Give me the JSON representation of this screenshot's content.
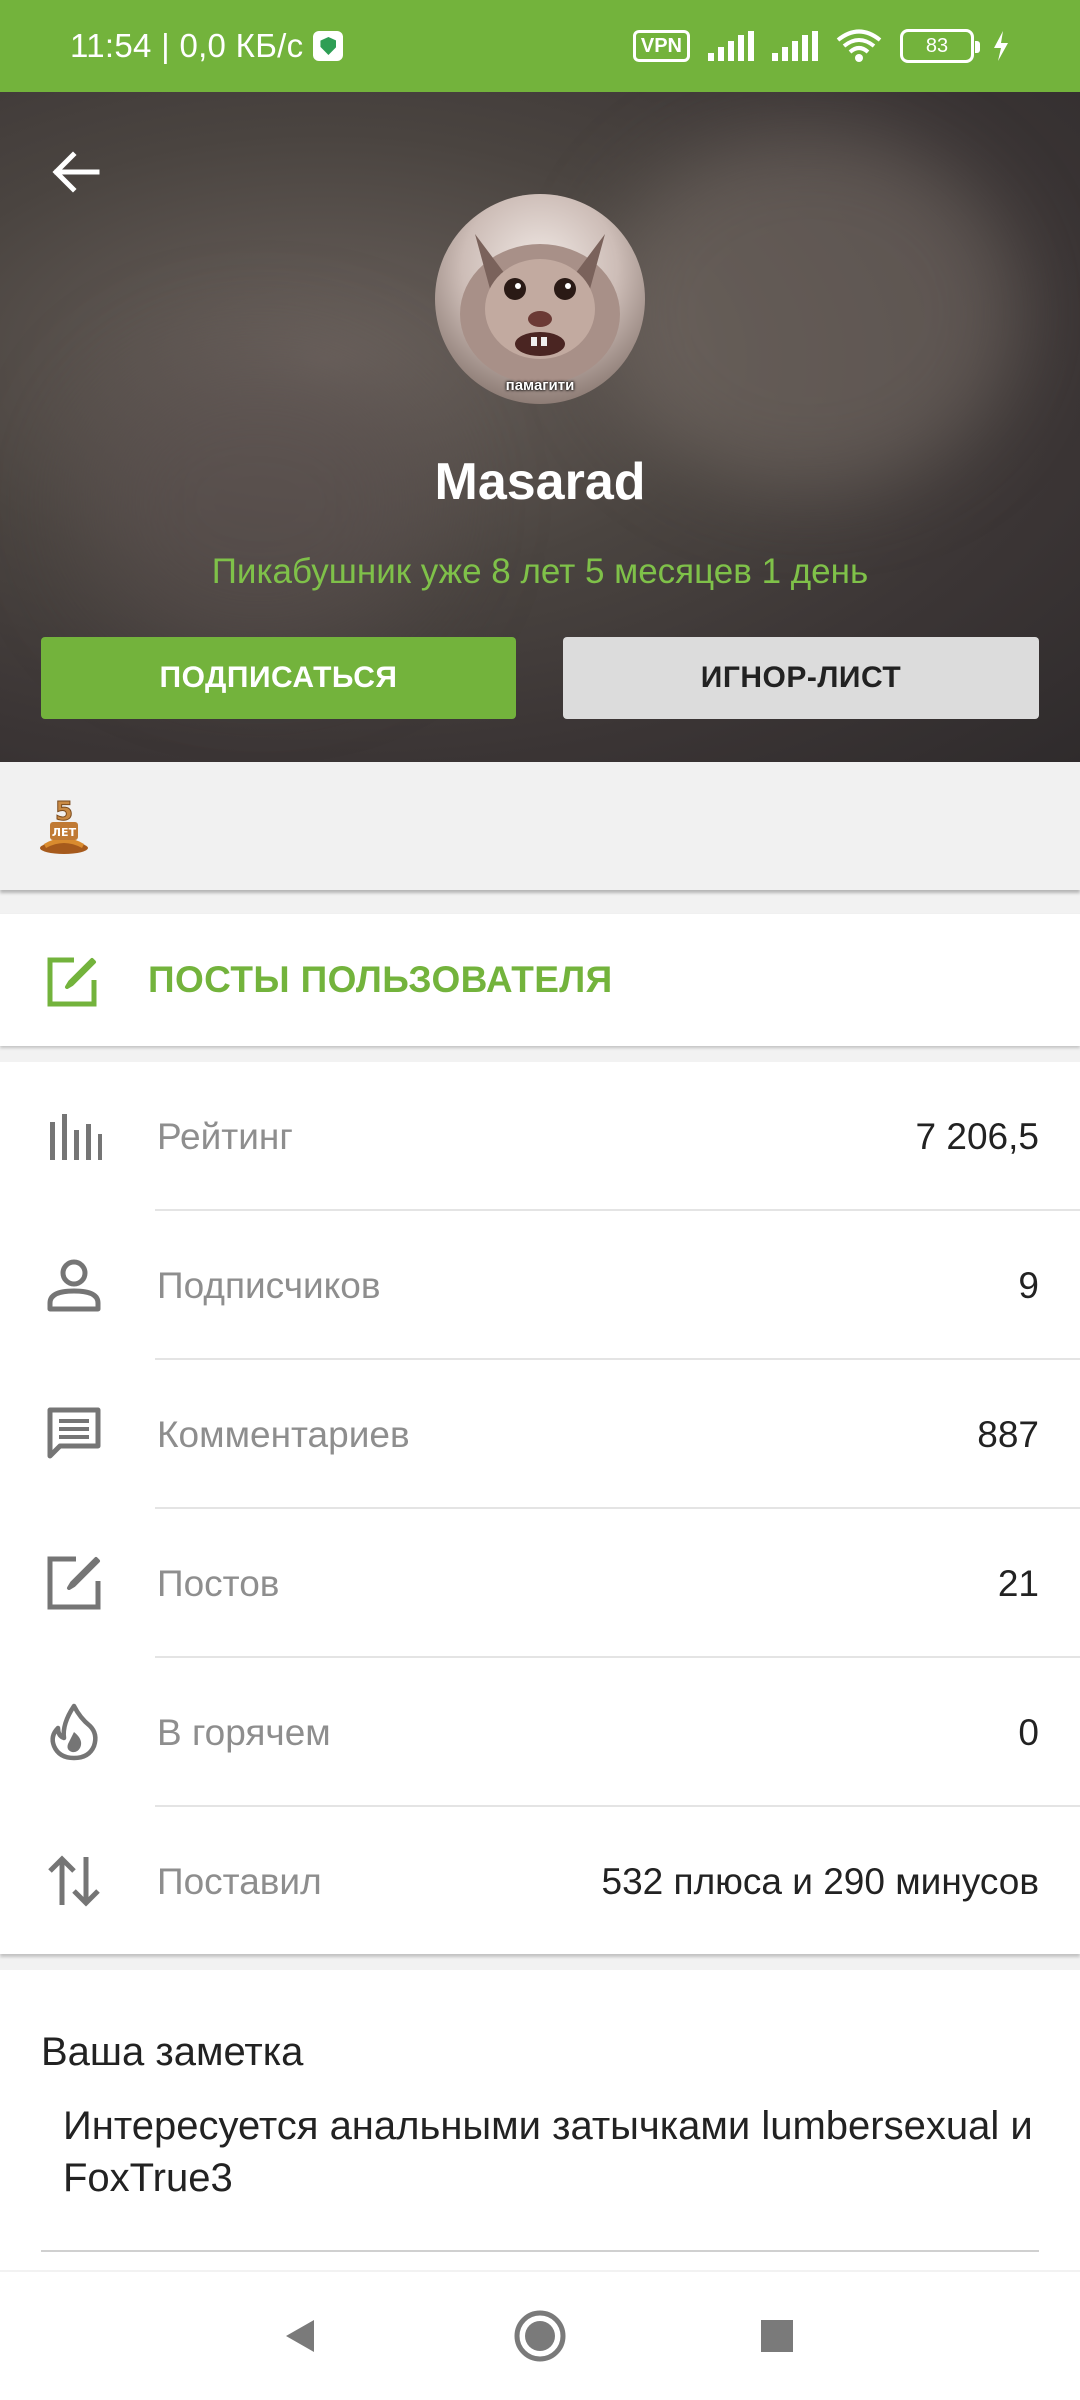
{
  "status_bar": {
    "time_speed": "11:54 | 0,0 КБ/с",
    "vpn": "VPN",
    "battery": "83",
    "shield_icon": "shield-check-icon"
  },
  "header": {
    "avatar_caption": "памагити",
    "username": "Masarad",
    "membership": "Пикабушник уже 8 лет 5 месяцев 1 день",
    "subscribe_label": "ПОДПИСАТЬСЯ",
    "ignore_label": "ИГНОР-ЛИСТ"
  },
  "awards": {
    "items": [
      {
        "icon": "5-years-award-icon",
        "text": "5 ЛЕТ"
      }
    ]
  },
  "posts_link": {
    "label": "ПОСТЫ ПОЛЬЗОВАТЕЛЯ",
    "icon": "edit-icon"
  },
  "stats": [
    {
      "icon": "rating-bars-icon",
      "label": "Рейтинг",
      "value": "7 206,5"
    },
    {
      "icon": "person-icon",
      "label": "Подписчиков",
      "value": "9"
    },
    {
      "icon": "comment-icon",
      "label": "Комментариев",
      "value": "887"
    },
    {
      "icon": "edit-icon",
      "label": "Постов",
      "value": "21"
    },
    {
      "icon": "flame-icon",
      "label": "В горячем",
      "value": "0"
    },
    {
      "icon": "sort-arrows-icon",
      "label": "Поставил",
      "value": "532 плюса и 290 минусов"
    }
  ],
  "note": {
    "title": "Ваша заметка",
    "text": "Интересуется анальными затычками lumbersexual и FoxTrue3"
  },
  "colors": {
    "accent": "#73b33c",
    "accent_text": "#7fc149",
    "muted_text": "#8e8e8e",
    "icon_gray": "#757575"
  }
}
